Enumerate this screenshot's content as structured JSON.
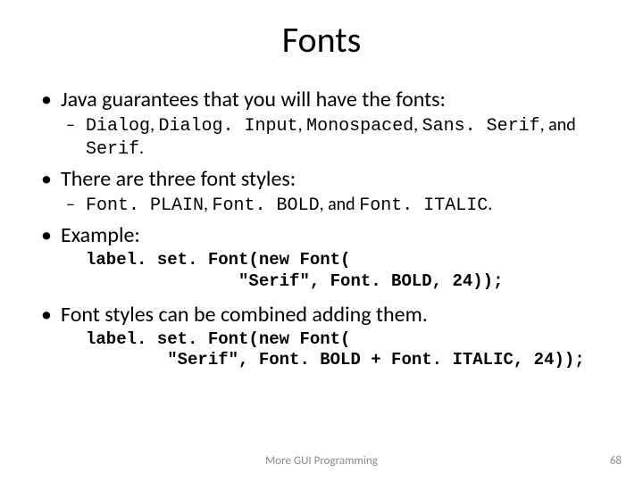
{
  "title": "Fonts",
  "b1": {
    "text": "Java guarantees that you will have the fonts:",
    "sub_pre": "",
    "sub_code1": "Dialog",
    "sub_t1": ", ",
    "sub_code2": "Dialog. Input",
    "sub_t2": ", ",
    "sub_code3": "Monospaced",
    "sub_t3": ", ",
    "sub_code4": "Sans. Serif",
    "sub_t4": ", and ",
    "sub_code5": "Serif",
    "sub_t5": "."
  },
  "b2": {
    "text": "There are three font styles:",
    "sub_code1": "Font. PLAIN",
    "sub_t1": ", ",
    "sub_code2": "Font. BOLD",
    "sub_t2": ", and ",
    "sub_code3": "Font. ITALIC",
    "sub_t3": "."
  },
  "b3": {
    "text": "Example:",
    "code": "label. set. Font(new Font(\n               \"Serif\", Font. BOLD, 24));"
  },
  "b4": {
    "text": "Font styles can be combined adding them.",
    "code": "label. set. Font(new Font(\n        \"Serif\", Font. BOLD + Font. ITALIC, 24));"
  },
  "footer": "More GUI Programming",
  "page": "68"
}
